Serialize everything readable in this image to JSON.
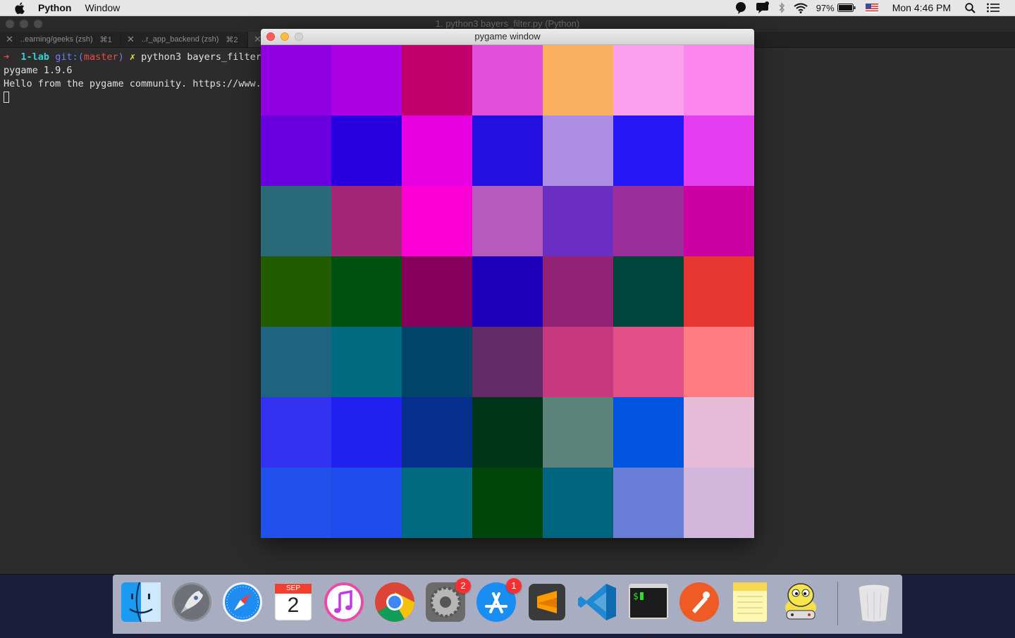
{
  "menubar": {
    "app_name": "Python",
    "items": [
      "Window"
    ],
    "battery": "97%",
    "clock": "Mon 4:46 PM"
  },
  "terminal": {
    "title": "1. python3 bayers_filter.py (Python)",
    "tabs": [
      {
        "label": "..earning/geeks (zsh)",
        "shortcut": "⌘1"
      },
      {
        "label": "..r_app_backend (zsh)",
        "shortcut": "⌘2"
      }
    ],
    "prompt": {
      "arrow": "➜",
      "dir": "1-lab",
      "git_label": "git:(",
      "branch": "master",
      "git_close": ")",
      "dirty": "✗",
      "command": "python3 bayers_filter.py"
    },
    "output": [
      "pygame 1.9.6",
      "Hello from the pygame community. https://www.pygame.org/contribute.html"
    ]
  },
  "pygame_window": {
    "title": "pygame window",
    "grid_colors": [
      [
        "#9000e0",
        "#ac00e2",
        "#c2006c",
        "#e050da",
        "#fab05e",
        "#faa0ee",
        "#fb86ee"
      ],
      [
        "#6a00e0",
        "#2800e0",
        "#e600e2",
        "#2210e0",
        "#ae8ee2",
        "#2418f6",
        "#e43ef0"
      ],
      [
        "#2a6a78",
        "#a42676",
        "#fc00d6",
        "#b65abe",
        "#6a2ec2",
        "#9a2e9a",
        "#cc00a0"
      ],
      [
        "#225c00",
        "#005210",
        "#86005c",
        "#1e00bc",
        "#922274",
        "#00443c",
        "#e83632"
      ],
      [
        "#1e6480",
        "#006a80",
        "#00446a",
        "#622a66",
        "#c8387e",
        "#e44e86",
        "#fe7c82"
      ],
      [
        "#3232f0",
        "#2222f0",
        "#062e8c",
        "#003418",
        "#5a8278",
        "#0054e0",
        "#e6bcd8"
      ],
      [
        "#2250ec",
        "#1e4cec",
        "#006a80",
        "#00460a",
        "#006680",
        "#6a7ed8",
        "#d2b6dc"
      ]
    ]
  },
  "dock": {
    "items": [
      {
        "name": "Finder",
        "running": true
      },
      {
        "name": "Launchpad",
        "running": false
      },
      {
        "name": "Safari",
        "running": false
      },
      {
        "name": "Calendar",
        "running": false,
        "month": "SEP",
        "day": "2"
      },
      {
        "name": "iTunes",
        "running": true
      },
      {
        "name": "Google Chrome",
        "running": true
      },
      {
        "name": "System Preferences",
        "running": false,
        "badge": "2"
      },
      {
        "name": "App Store",
        "running": false,
        "badge": "1"
      },
      {
        "name": "Sublime Text",
        "running": true
      },
      {
        "name": "Visual Studio Code",
        "running": false
      },
      {
        "name": "Terminal",
        "running": true
      },
      {
        "name": "Postman",
        "running": false
      },
      {
        "name": "Notes",
        "running": true
      },
      {
        "name": "Python",
        "running": true
      },
      {
        "name": "Trash",
        "running": false
      }
    ]
  }
}
